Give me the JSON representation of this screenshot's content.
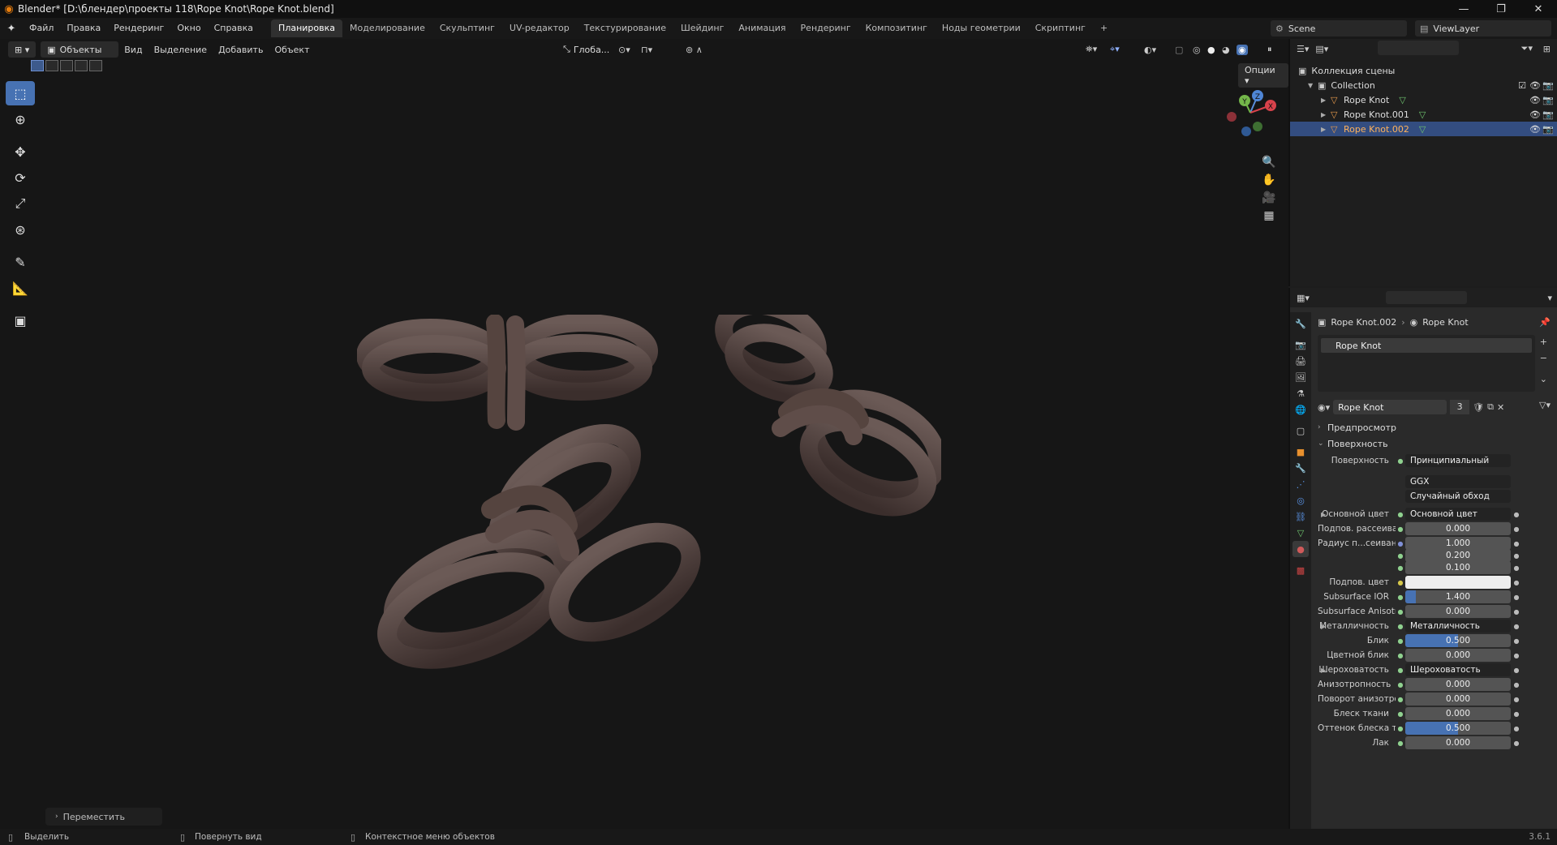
{
  "window": {
    "title": "Blender* [D:\\блендер\\проекты 118\\Rope Knot\\Rope Knot.blend]",
    "controls": [
      "—",
      "❐",
      "✕"
    ]
  },
  "menu": [
    "Файл",
    "Правка",
    "Рендеринг",
    "Окно",
    "Справка"
  ],
  "workspaces": [
    "Планировка",
    "Моделирование",
    "Скульптинг",
    "UV-редактор",
    "Текстурирование",
    "Шейдинг",
    "Анимация",
    "Рендеринг",
    "Композитинг",
    "Ноды геометрии",
    "Скриптинг",
    "+"
  ],
  "active_workspace": "Планировка",
  "scene": "Scene",
  "view_layer": "ViewLayer",
  "viewport": {
    "mode": "Объекты",
    "menus": [
      "Вид",
      "Выделение",
      "Добавить",
      "Объект"
    ],
    "transform_orientation": "Глоба...",
    "options": "Опции",
    "last_operator": "Переместить",
    "gizmo_labels": [
      "Z",
      "Y",
      "X"
    ]
  },
  "outliner": {
    "root": "Коллекция сцены",
    "collection": "Collection",
    "objects": [
      {
        "name": "Rope Knot",
        "selected": false
      },
      {
        "name": "Rope Knot.001",
        "selected": false
      },
      {
        "name": "Rope Knot.002",
        "selected": true
      }
    ]
  },
  "properties": {
    "breadcrumb_object": "Rope Knot.002",
    "breadcrumb_material": "Rope Knot",
    "material_slot": "Rope Knot",
    "material_name": "Rope Knot",
    "material_users": "3",
    "panels": {
      "preview": "Предпросмотр",
      "surface": "Поверхность"
    },
    "surface_label": "Поверхность",
    "surface_shader": "Принципиальный BSDF",
    "distribution": "GGX",
    "subsurface_method": "Случайный обход",
    "rows": [
      {
        "label": "Основной цвет",
        "value": "Основной цвет",
        "kind": "link"
      },
      {
        "label": "Подпов. рассеива...",
        "value": "0.000",
        "kind": "num"
      },
      {
        "label": "Радиус п...сеивания",
        "value": "1.000",
        "kind": "num"
      },
      {
        "label": "",
        "value": "0.200",
        "kind": "num"
      },
      {
        "label": "",
        "value": "0.100",
        "kind": "num"
      },
      {
        "label": "Подпов. цвет",
        "value": "",
        "kind": "color"
      },
      {
        "label": "Subsurface IOR",
        "value": "1.400",
        "kind": "slider",
        "fill": 0.1
      },
      {
        "label": "Subsurface Anisotr...",
        "value": "0.000",
        "kind": "num"
      },
      {
        "label": "Металличность",
        "value": "Металличность",
        "kind": "link"
      },
      {
        "label": "Блик",
        "value": "0.500",
        "kind": "slider",
        "fill": 0.5
      },
      {
        "label": "Цветной блик",
        "value": "0.000",
        "kind": "num"
      },
      {
        "label": "Шероховатость",
        "value": "Шероховатость",
        "kind": "link"
      },
      {
        "label": "Анизотропность",
        "value": "0.000",
        "kind": "num"
      },
      {
        "label": "Поворот анизотро...",
        "value": "0.000",
        "kind": "num"
      },
      {
        "label": "Блеск ткани",
        "value": "0.000",
        "kind": "num"
      },
      {
        "label": "Оттенок блеска тк...",
        "value": "0.500",
        "kind": "slider",
        "fill": 0.5
      },
      {
        "label": "Лак",
        "value": "0.000",
        "kind": "num"
      }
    ]
  },
  "status": {
    "select": "Выделить",
    "rotate": "Повернуть вид",
    "context": "Контекстное меню объектов",
    "version": "3.6.1"
  },
  "colors": {
    "accent": "#4772b3",
    "selected_row": "#334d80",
    "rope": "#5a4a47"
  }
}
